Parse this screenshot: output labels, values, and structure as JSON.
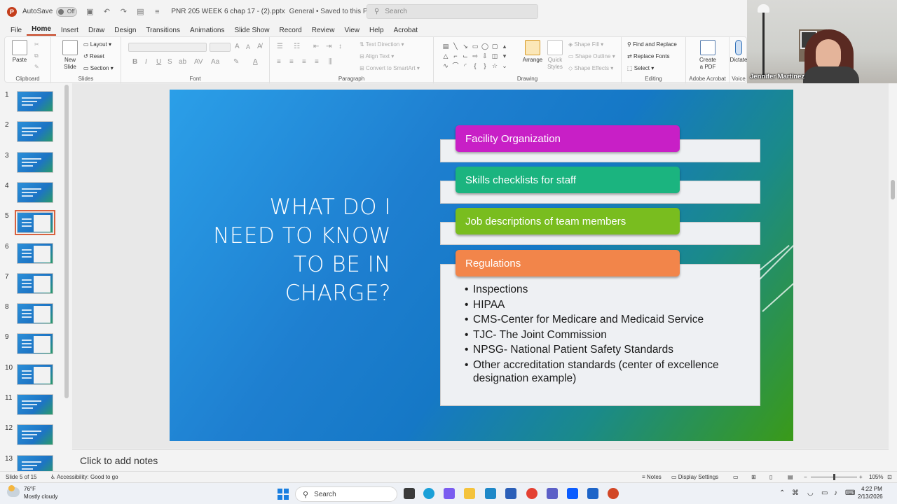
{
  "titlebar": {
    "autosave_label": "AutoSave",
    "autosave_state": "Off",
    "filename": "PNR 205 WEEK 6 chap 17 - (2).pptx",
    "save_status": "General • Saved to this PC",
    "search_placeholder": "Search"
  },
  "menu": [
    "File",
    "Home",
    "Insert",
    "Draw",
    "Design",
    "Transitions",
    "Animations",
    "Slide Show",
    "Record",
    "Review",
    "View",
    "Help",
    "Acrobat"
  ],
  "active_menu": "Home",
  "ribbon": {
    "clipboard": {
      "label": "Clipboard",
      "paste": "Paste"
    },
    "slides": {
      "label": "Slides",
      "new_slide_1": "New",
      "new_slide_2": "Slide",
      "layout": "Layout",
      "reset": "Reset",
      "section": "Section"
    },
    "font": {
      "label": "Font"
    },
    "paragraph": {
      "label": "Paragraph",
      "text_direction": "Text Direction",
      "align_text": "Align Text",
      "convert_smartart": "Convert to SmartArt"
    },
    "drawing": {
      "label": "Drawing",
      "arrange": "Arrange",
      "quick_styles_1": "Quick",
      "quick_styles_2": "Styles",
      "shape_fill": "Shape Fill",
      "shape_outline": "Shape Outline",
      "shape_effects": "Shape Effects"
    },
    "editing": {
      "label": "Editing",
      "find_replace": "Find and Replace",
      "replace_fonts": "Replace Fonts",
      "select": "Select"
    },
    "acrobat": {
      "label": "Adobe Acrobat",
      "create_pdf_1": "Create",
      "create_pdf_2": "a PDF"
    },
    "voice": {
      "label": "Voice",
      "dictate": "Dictate"
    }
  },
  "thumbnails": [
    {
      "num": "1"
    },
    {
      "num": "2"
    },
    {
      "num": "3"
    },
    {
      "num": "4"
    },
    {
      "num": "5"
    },
    {
      "num": "6"
    },
    {
      "num": "7"
    },
    {
      "num": "8"
    },
    {
      "num": "9"
    },
    {
      "num": "10"
    },
    {
      "num": "11"
    },
    {
      "num": "12"
    },
    {
      "num": "13"
    }
  ],
  "selected_slide": 5,
  "slide": {
    "title_lines": [
      "WHAT DO I",
      "NEED TO KNOW",
      "TO BE IN",
      "CHARGE?"
    ],
    "items": [
      {
        "label": "Facility Organization",
        "color": "#c81fc6"
      },
      {
        "label": "Skills checklists for staff",
        "color": "#1bb47f"
      },
      {
        "label": "Job descriptions of team members",
        "color": "#79bd1f"
      },
      {
        "label": "Regulations",
        "color": "#f2854a"
      }
    ],
    "bullets": [
      "Inspections",
      "HIPAA",
      "CMS-Center for Medicare and Medicaid Service",
      "TJC- The Joint Commission",
      "NPSG- National Patient Safety Standards",
      "Other  accreditation standards (center of excellence designation example)"
    ]
  },
  "notes_placeholder": "Click to add notes",
  "statusbar": {
    "slide_count": "Slide 5 of 15",
    "accessibility": "Accessibility: Good to go",
    "notes": "Notes",
    "display_settings": "Display Settings",
    "zoom": "105%"
  },
  "taskbar": {
    "temperature": "76°F",
    "weather": "Mostly cloudy",
    "search": "Search",
    "time": "4:22 PM",
    "date": "2/13/2026"
  },
  "video": {
    "participant_name": "Jennifer Martinez"
  }
}
